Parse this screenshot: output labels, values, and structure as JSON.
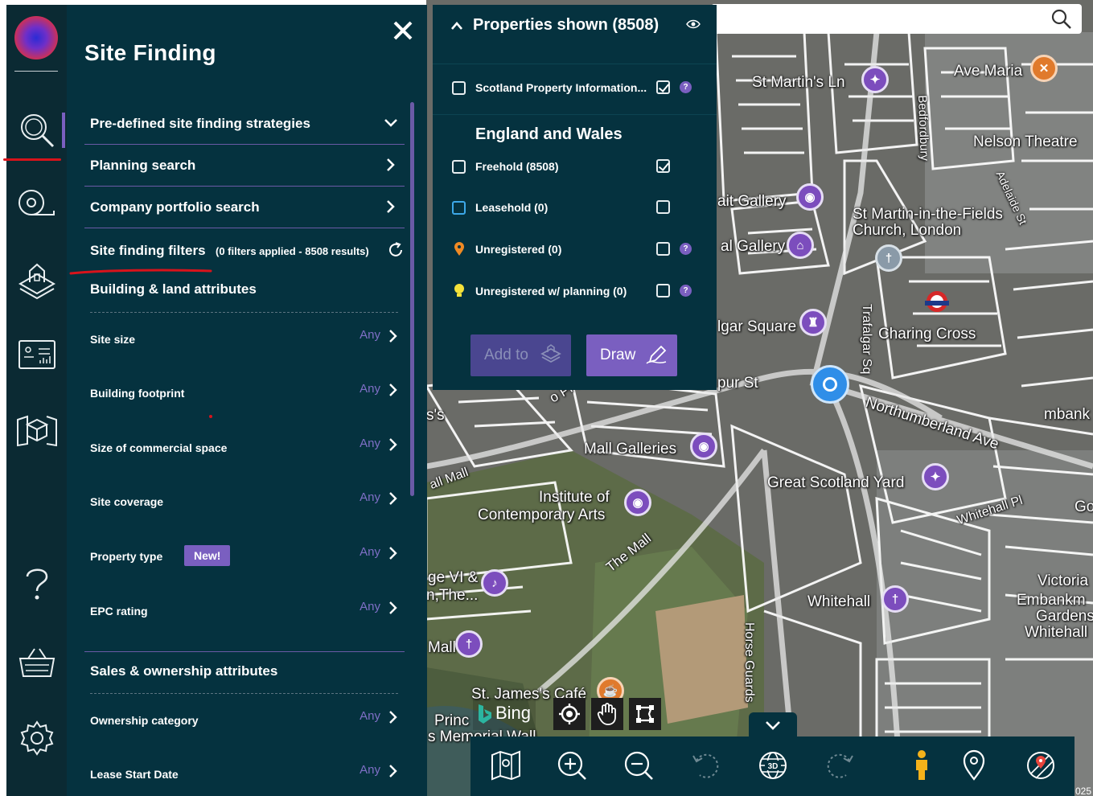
{
  "map": {
    "labels": [
      {
        "id": "st-martins-ln",
        "text": "St Martin's Ln"
      },
      {
        "id": "ave-maria",
        "text": "Ave Maria"
      },
      {
        "id": "bedfordbury",
        "text": "Bedfordbury"
      },
      {
        "id": "nelson",
        "text": "Nelson Theatre"
      },
      {
        "id": "adelaide",
        "text": "Adelaide St"
      },
      {
        "id": "portrait-gallery",
        "text": "ait Gallery"
      },
      {
        "id": "st-martin-church",
        "text": "St Martin-in-the-Fields"
      },
      {
        "id": "church-london",
        "text": "Church, London"
      },
      {
        "id": "national-gallery",
        "text": "al Gallery"
      },
      {
        "id": "trafalgar-square",
        "text": "lgar Square"
      },
      {
        "id": "charing-cross",
        "text": "Charing Cross"
      },
      {
        "id": "trafalgar-sq-road",
        "text": "Trafalgar Sq"
      },
      {
        "id": "cockspur",
        "text": "pur St"
      },
      {
        "id": "northumberland",
        "text": "Northumberland Ave"
      },
      {
        "id": "embank",
        "text": "mbank"
      },
      {
        "id": "mall-galleries",
        "text": "Mall Galleries"
      },
      {
        "id": "pall-mall",
        "text": "o Pl  Pall"
      },
      {
        "id": "institute",
        "text": "Institute of"
      },
      {
        "id": "contemporary",
        "text": "Contemporary Arts"
      },
      {
        "id": "great-scotland",
        "text": "Great Scotland Yard"
      },
      {
        "id": "whitehall-pl",
        "text": "Whitehall Pl"
      },
      {
        "id": "the-mall",
        "text": "The Mall"
      },
      {
        "id": "whitehall",
        "text": "Whitehall"
      },
      {
        "id": "victoria",
        "text": "Victoria"
      },
      {
        "id": "embankment",
        "text": "Embankm"
      },
      {
        "id": "gardens",
        "text": "Gardens"
      },
      {
        "id": "whitehall2",
        "text": "Whitehall"
      },
      {
        "id": "horse-guards",
        "text": "Horse Guards"
      },
      {
        "id": "st-james-cafe",
        "text": "St. James's Café"
      },
      {
        "id": "princ",
        "text": "Princ"
      },
      {
        "id": "memorial",
        "text": "s Memorial Wall"
      },
      {
        "id": "george",
        "text": "ge VI &"
      },
      {
        "id": "the",
        "text": "n,The..."
      },
      {
        "id": "mall-left",
        "text": "Mall"
      },
      {
        "id": "s-left",
        "text": "s's"
      },
      {
        "id": "pall-mall-left",
        "text": "all Mall"
      },
      {
        "id": "go",
        "text": "Go"
      }
    ],
    "copyright": "025"
  },
  "rail": {
    "items": [
      {
        "id": "search",
        "icon": "search-icon"
      },
      {
        "id": "measure",
        "icon": "measuring-tape-icon"
      },
      {
        "id": "building",
        "icon": "building-layers-icon"
      },
      {
        "id": "dashboard",
        "icon": "dashboard-icon"
      },
      {
        "id": "3d-box",
        "icon": "map-box-icon"
      },
      {
        "id": "help",
        "icon": "question-icon"
      },
      {
        "id": "basket",
        "icon": "basket-icon"
      },
      {
        "id": "settings",
        "icon": "gear-icon"
      }
    ]
  },
  "panel": {
    "title": "Site Finding",
    "sections": [
      {
        "label": "Pre-defined site finding strategies",
        "chevron": "down"
      },
      {
        "label": "Planning search",
        "chevron": "right"
      },
      {
        "label": "Company portfolio search",
        "chevron": "right"
      }
    ],
    "filters_title": "Site finding filters",
    "filters_summary": "(0 filters applied - 8508 results)",
    "group1": "Building & land attributes",
    "group1_rows": [
      {
        "label": "Site size",
        "value": "Any"
      },
      {
        "label": "Building footprint",
        "value": "Any"
      },
      {
        "label": "Size of commercial space",
        "value": "Any"
      },
      {
        "label": "Site coverage",
        "value": "Any"
      },
      {
        "label": "Property type",
        "value": "Any",
        "badge": "New!"
      },
      {
        "label": "EPC rating",
        "value": "Any"
      }
    ],
    "group2": "Sales & ownership attributes",
    "group2_rows": [
      {
        "label": "Ownership category",
        "value": "Any"
      },
      {
        "label": "Lease Start Date",
        "value": "Any"
      }
    ]
  },
  "properties": {
    "title": "Properties shown (8508)",
    "scotland": {
      "label": "Scotland Property Information...",
      "checked": true
    },
    "england_heading": "England and Wales",
    "rows": [
      {
        "label": "Freehold (8508)",
        "checked": true,
        "help": false
      },
      {
        "label": "Leasehold (0)",
        "checked": false,
        "help": false
      },
      {
        "label": "Unregistered (0)",
        "checked": false,
        "help": true
      },
      {
        "label": "Unregistered w/ planning (0)",
        "checked": false,
        "help": true
      }
    ],
    "add_label": "Add to",
    "draw_label": "Draw"
  },
  "tools": {
    "bing_label": "Bing"
  },
  "colors": {
    "panel": "#05323f",
    "rail": "#0b2a33",
    "accent": "#7a5fc0",
    "red_annotation": "#d8131b"
  }
}
